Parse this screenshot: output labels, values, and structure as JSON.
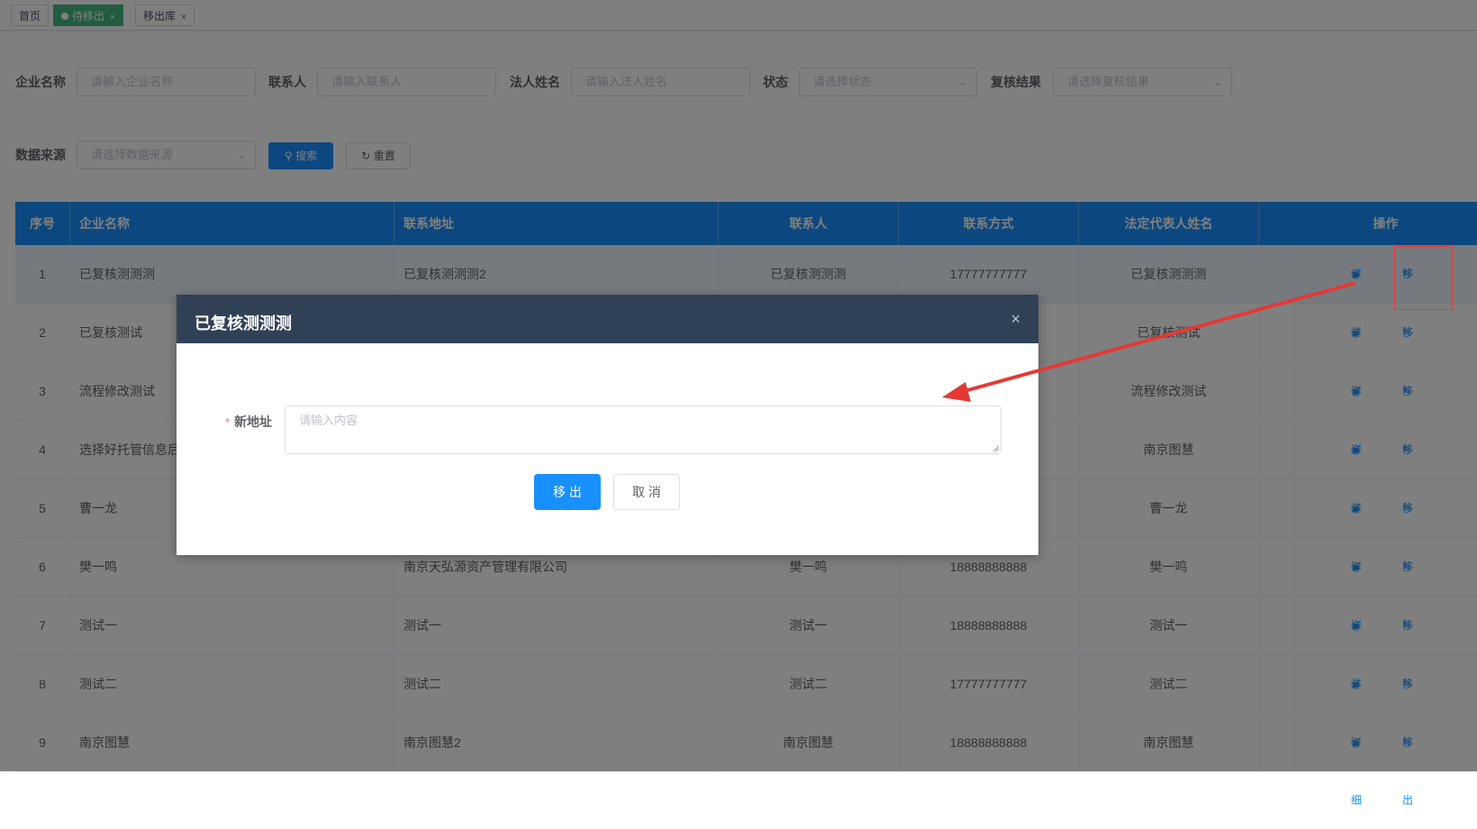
{
  "tags": [
    {
      "label": "首页",
      "active": false
    },
    {
      "label": "待移出",
      "active": true,
      "close": "×"
    },
    {
      "label": "移出库",
      "active": false,
      "close": "×"
    }
  ],
  "search": {
    "company_label": "企业名称",
    "company_placeholder": "请输入企业名称",
    "contact_label": "联系人",
    "contact_placeholder": "请输入联系人",
    "legal_label": "法人姓名",
    "legal_placeholder": "请输入法人姓名",
    "status_label": "状态",
    "status_placeholder": "请选择状态",
    "review_label": "复核结果",
    "review_placeholder": "请选择复核结果",
    "source_label": "数据来源",
    "source_placeholder": "请选择数据来源",
    "search_button": "搜索",
    "reset_button": "重置"
  },
  "table": {
    "headers": [
      "序号",
      "企业名称",
      "联系地址",
      "联系人",
      "联系方式",
      "法定代表人姓名",
      "操作"
    ],
    "detail_label": "详细",
    "remove_label": "移出",
    "rows": [
      {
        "no": "1",
        "company": "已复核测测测",
        "address": "已复核测测测2",
        "contact": "已复核测测测",
        "phone": "17777777777",
        "legal": "已复核测测测"
      },
      {
        "no": "2",
        "company": "已复核测试",
        "address": "",
        "contact": "",
        "phone": "",
        "legal": "已复核测试"
      },
      {
        "no": "3",
        "company": "流程修改测试",
        "address": "",
        "contact": "",
        "phone": "",
        "legal": "流程修改测试"
      },
      {
        "no": "4",
        "company": "选择好托管信息后",
        "address": "",
        "contact": "",
        "phone": "",
        "legal": "南京图慧"
      },
      {
        "no": "5",
        "company": "曹一龙",
        "address": "",
        "contact": "",
        "phone": "",
        "legal": "曹一龙"
      },
      {
        "no": "6",
        "company": "樊一鸣",
        "address": "南京天弘源资产管理有限公司",
        "contact": "樊一鸣",
        "phone": "18888888888",
        "legal": "樊一鸣"
      },
      {
        "no": "7",
        "company": "测试一",
        "address": "测试一",
        "contact": "测试一",
        "phone": "18888888888",
        "legal": "测试一"
      },
      {
        "no": "8",
        "company": "测试二",
        "address": "测试二",
        "contact": "测试二",
        "phone": "17777777777",
        "legal": "测试二"
      },
      {
        "no": "9",
        "company": "南京图慧",
        "address": "南京图慧2",
        "contact": "南京图慧",
        "phone": "18888888888",
        "legal": "南京图慧"
      }
    ]
  },
  "dialog": {
    "title": "已复核测测测",
    "required_mark": "*",
    "field_label": "新地址",
    "field_placeholder": "请输入内容",
    "confirm_button": "移 出",
    "cancel_button": "取 消",
    "close_glyph": "×"
  },
  "colors": {
    "primary": "#1890ff",
    "dialog_header": "#304156",
    "annotation": "#e53935",
    "active_tag": "#42b983"
  }
}
